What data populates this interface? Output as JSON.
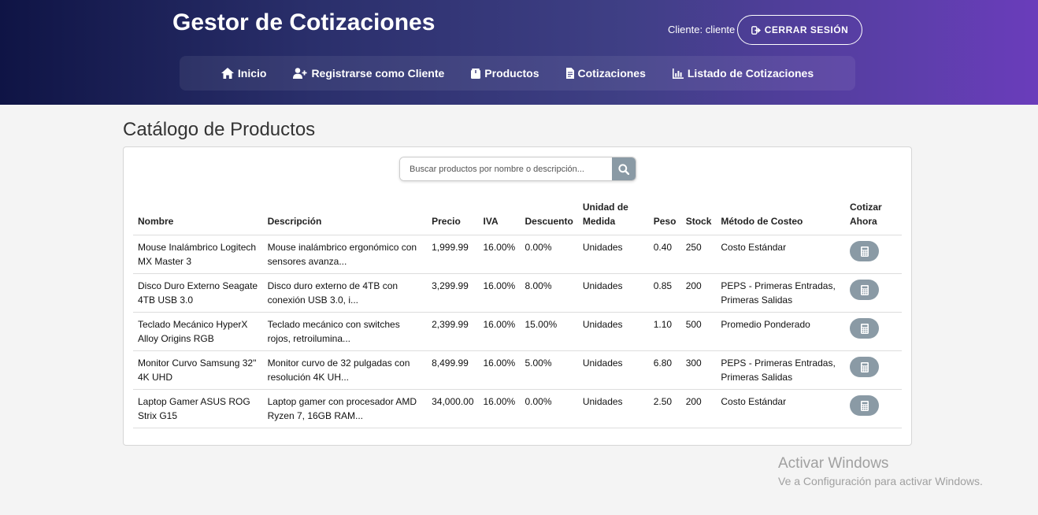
{
  "header": {
    "title": "Gestor de Cotizaciones",
    "client_label": "Cliente: cliente",
    "logout_label": "CERRAR SESIÓN",
    "nav": [
      {
        "label": "Inicio",
        "icon": "home-icon"
      },
      {
        "label": "Registrarse como Cliente",
        "icon": "user-plus-icon"
      },
      {
        "label": "Productos",
        "icon": "box-icon"
      },
      {
        "label": "Cotizaciones",
        "icon": "file-invoice-icon"
      },
      {
        "label": "Listado de Cotizaciones",
        "icon": "chart-icon"
      }
    ]
  },
  "main": {
    "title": "Catálogo de Productos",
    "search": {
      "placeholder": "Buscar productos por nombre o descripción...",
      "icon": "search-icon"
    },
    "table": {
      "headers": [
        "Nombre",
        "Descripción",
        "Precio",
        "IVA",
        "Descuento",
        "Unidad de Medida",
        "Peso",
        "Stock",
        "Método de Costeo",
        "Cotizar Ahora"
      ],
      "rows": [
        {
          "nombre": "Mouse Inalámbrico Logitech MX Master 3",
          "descripcion": "Mouse inalámbrico ergonómico con sensores avanza...",
          "precio": "1,999.99",
          "iva": "16.00%",
          "descuento": "0.00%",
          "unidad": "Unidades",
          "peso": "0.40",
          "stock": "250",
          "metodo": "Costo Estándar"
        },
        {
          "nombre": "Disco Duro Externo Seagate 4TB USB 3.0",
          "descripcion": "Disco duro externo de 4TB con conexión USB 3.0, i...",
          "precio": "3,299.99",
          "iva": "16.00%",
          "descuento": "8.00%",
          "unidad": "Unidades",
          "peso": "0.85",
          "stock": "200",
          "metodo": "PEPS - Primeras Entradas, Primeras Salidas"
        },
        {
          "nombre": "Teclado Mecánico HyperX Alloy Origins RGB",
          "descripcion": "Teclado mecánico con switches rojos, retroilumina...",
          "precio": "2,399.99",
          "iva": "16.00%",
          "descuento": "15.00%",
          "unidad": "Unidades",
          "peso": "1.10",
          "stock": "500",
          "metodo": "Promedio Ponderado"
        },
        {
          "nombre": "Monitor Curvo Samsung 32\" 4K UHD",
          "descripcion": "Monitor curvo de 32 pulgadas con resolución 4K UH...",
          "precio": "8,499.99",
          "iva": "16.00%",
          "descuento": "5.00%",
          "unidad": "Unidades",
          "peso": "6.80",
          "stock": "300",
          "metodo": "PEPS - Primeras Entradas, Primeras Salidas"
        },
        {
          "nombre": "Laptop Gamer ASUS ROG Strix G15",
          "descripcion": "Laptop gamer con procesador AMD Ryzen 7, 16GB RAM...",
          "precio": "34,000.00",
          "iva": "16.00%",
          "descuento": "0.00%",
          "unidad": "Unidades",
          "peso": "2.50",
          "stock": "200",
          "metodo": "Costo Estándar"
        }
      ]
    }
  },
  "watermark": {
    "title": "Activar Windows",
    "subtitle": "Ve a Configuración para activar Windows."
  },
  "colors": {
    "header_start": "#0f1445",
    "header_end": "#6a3dbb",
    "button_gray": "#8a9aa5"
  }
}
